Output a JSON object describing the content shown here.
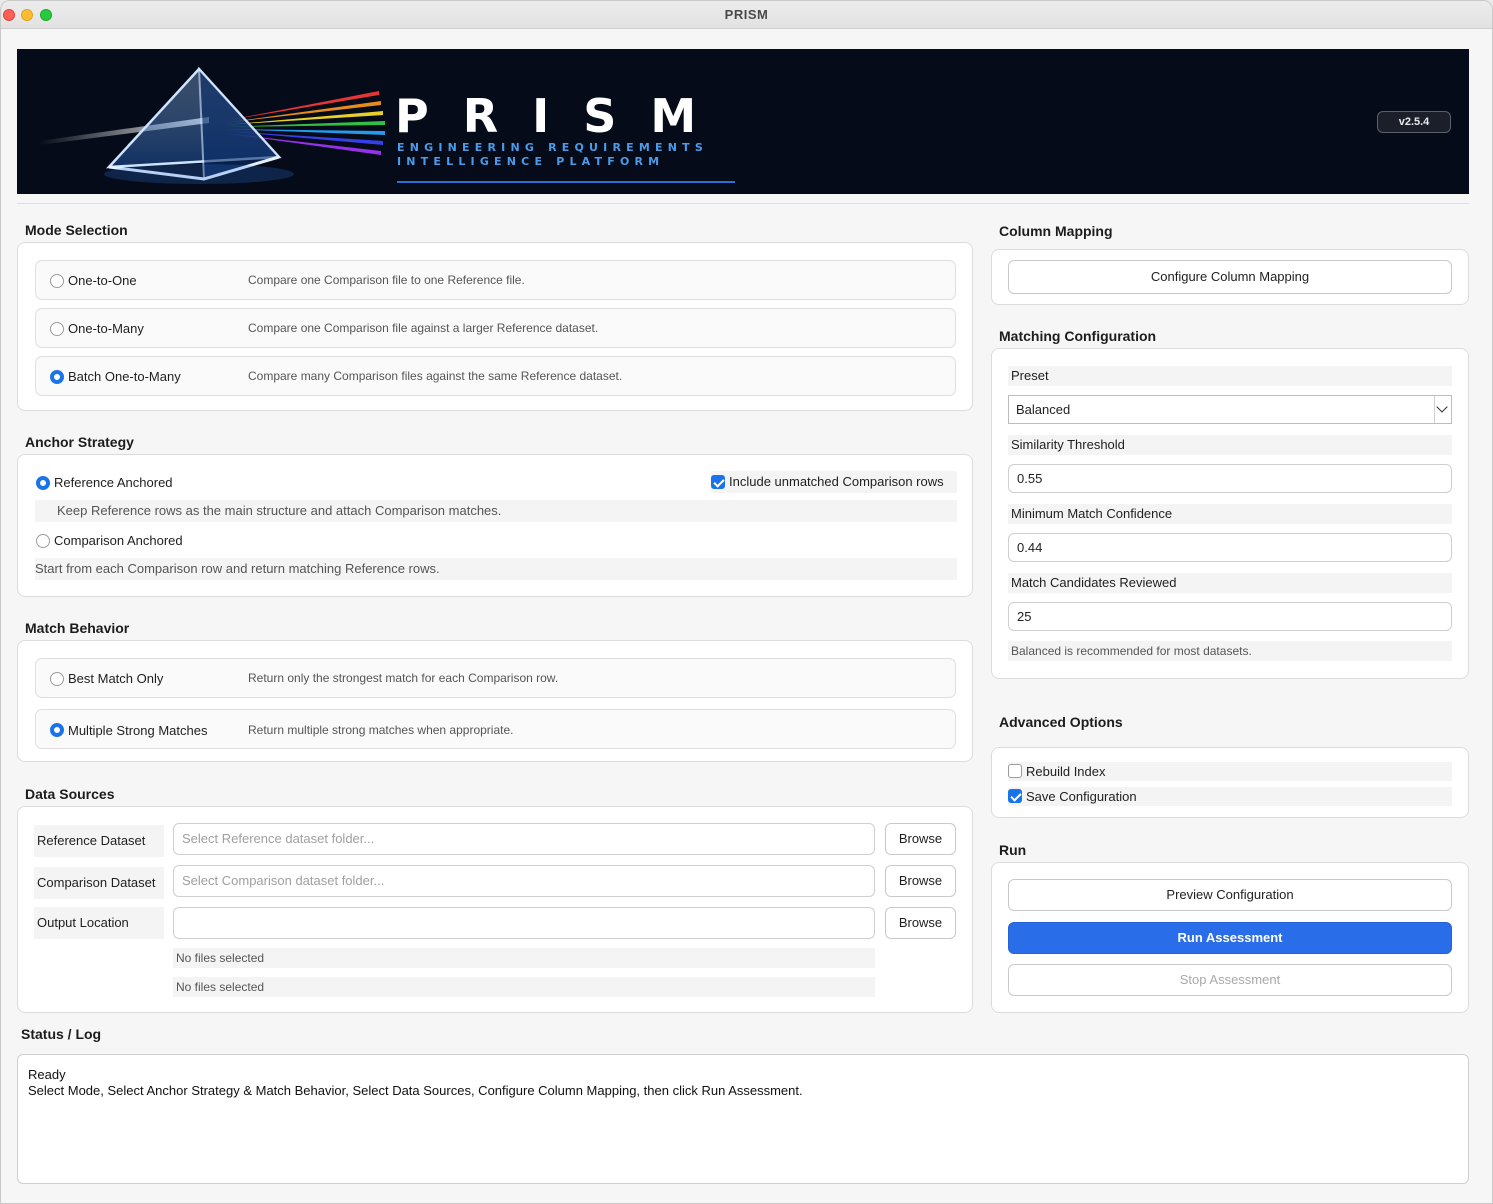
{
  "window": {
    "title": "PRISM"
  },
  "banner": {
    "logo_text": "PRISM",
    "tagline_line1": "ENGINEERING REQUIREMENTS",
    "tagline_line2": "INTELLIGENCE PLATFORM",
    "version": "v2.5.4",
    "colors": {
      "background": "#050b18",
      "logo": "#ffffff",
      "tagline": "#4d9be8"
    }
  },
  "mode_selection": {
    "title": "Mode Selection",
    "options": [
      {
        "label": "One-to-One",
        "description": "Compare one Comparison file to one Reference file.",
        "selected": false
      },
      {
        "label": "One-to-Many",
        "description": "Compare one Comparison file against a larger Reference dataset.",
        "selected": false
      },
      {
        "label": "Batch One-to-Many",
        "description": "Compare many Comparison files against the same Reference dataset.",
        "selected": true
      }
    ]
  },
  "anchor_strategy": {
    "title": "Anchor Strategy",
    "options": [
      {
        "label": "Reference Anchored",
        "description": "Keep Reference rows as the main structure and attach Comparison matches.",
        "selected": true
      },
      {
        "label": "Comparison Anchored",
        "description": "Start from each Comparison row and return matching Reference rows.",
        "selected": false
      }
    ],
    "include_unmatched_label": "Include unmatched Comparison rows",
    "include_unmatched_checked": true
  },
  "match_behavior": {
    "title": "Match Behavior",
    "options": [
      {
        "label": "Best Match Only",
        "description": "Return only the strongest match for each Comparison row.",
        "selected": false
      },
      {
        "label": "Multiple Strong Matches",
        "description": "Return multiple strong matches when appropriate.",
        "selected": true
      }
    ]
  },
  "data_sources": {
    "title": "Data Sources",
    "rows": [
      {
        "label": "Reference Dataset",
        "value": "",
        "placeholder": "Select Reference dataset folder...",
        "button": "Browse"
      },
      {
        "label": "Comparison Dataset",
        "value": "",
        "placeholder": "Select Comparison dataset folder...",
        "button": "Browse"
      },
      {
        "label": "Output Location",
        "value": "",
        "placeholder": "",
        "button": "Browse"
      }
    ],
    "file_status": [
      "No files selected",
      "No files selected"
    ]
  },
  "column_mapping": {
    "title": "Column Mapping",
    "button": "Configure Column Mapping"
  },
  "matching_configuration": {
    "title": "Matching Configuration",
    "preset_label": "Preset",
    "preset_value": "Balanced",
    "similarity_label": "Similarity Threshold",
    "similarity_value": "0.55",
    "confidence_label": "Minimum Match Confidence",
    "confidence_value": "0.44",
    "candidates_label": "Match Candidates Reviewed",
    "candidates_value": "25",
    "hint": "Balanced is recommended for most datasets."
  },
  "advanced_options": {
    "title": "Advanced Options",
    "rebuild_index_label": "Rebuild Index",
    "rebuild_index_checked": false,
    "save_config_label": "Save Configuration",
    "save_config_checked": true
  },
  "run": {
    "title": "Run",
    "preview_button": "Preview Configuration",
    "run_button": "Run Assessment",
    "stop_button": "Stop Assessment"
  },
  "status_log": {
    "title": "Status / Log",
    "lines": [
      "Ready",
      "Select Mode, Select Anchor Strategy & Match Behavior, Select Data Sources, Configure Column Mapping, then click Run Assessment."
    ]
  },
  "colors": {
    "accent": "#1a73e8",
    "primary_button": "#2a6de8"
  }
}
